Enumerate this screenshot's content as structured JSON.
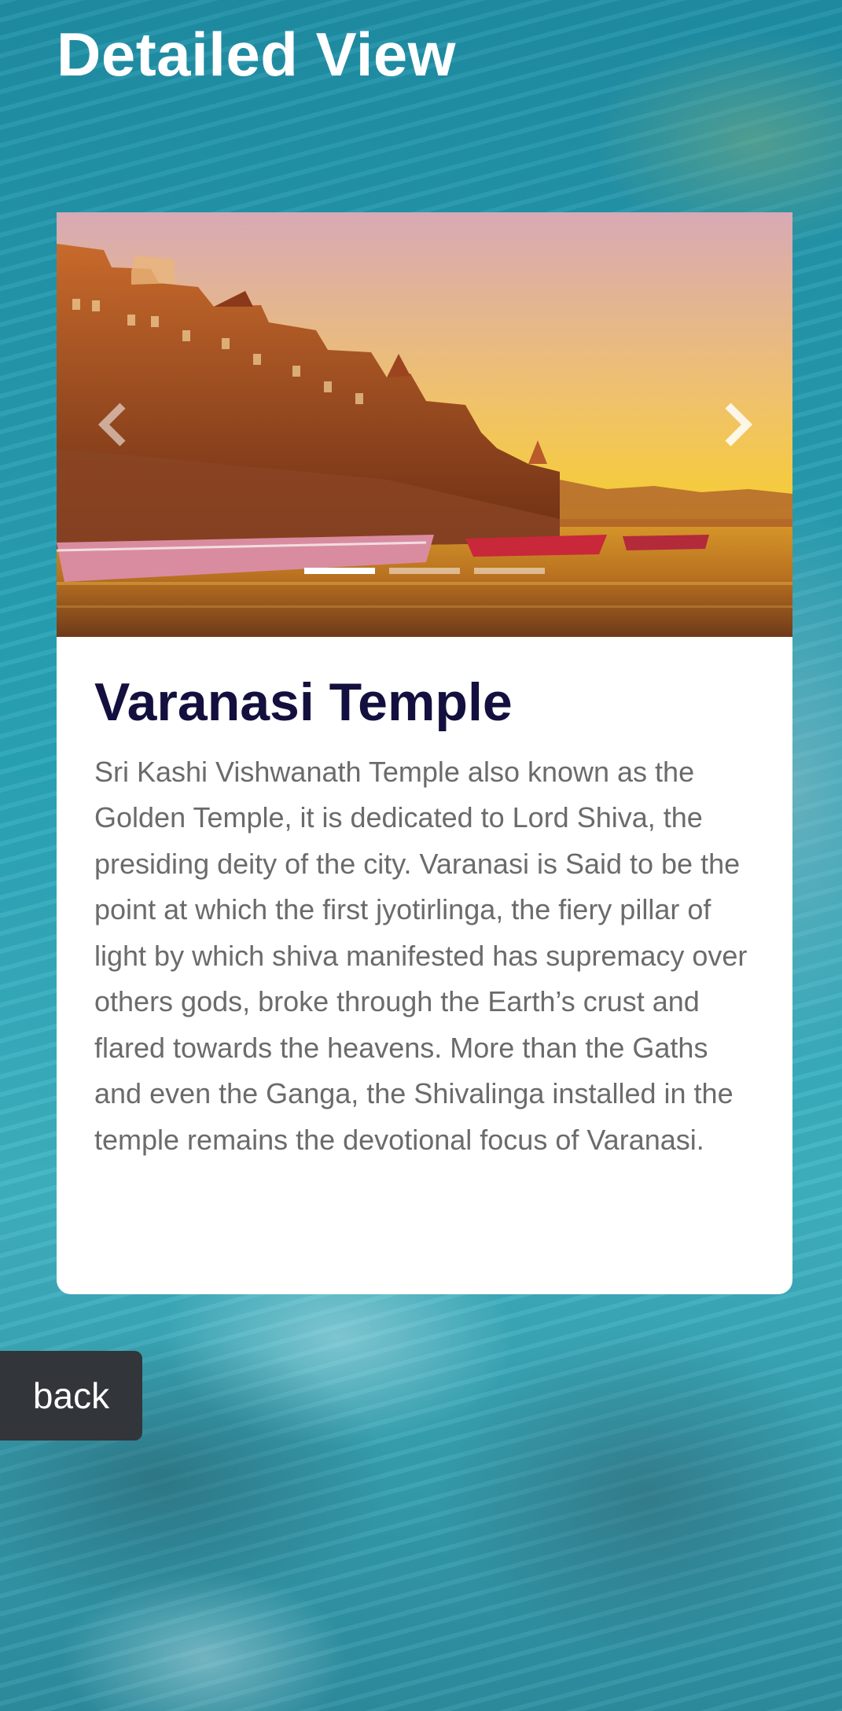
{
  "header": {
    "title": "Detailed View"
  },
  "carousel": {
    "image_alt": "Varanasi ghats at sunset",
    "prev_icon": "chevron-left-icon",
    "next_icon": "chevron-right-icon",
    "slide_count": 3,
    "active_slide": 1
  },
  "card": {
    "title": "Varanasi Temple",
    "description": "Sri Kashi Vishwanath Temple also known as the Golden Temple, it is dedicated to Lord Shiva, the presiding deity of the city. Varanasi is Said to be the point at which the first jyotirlinga, the fiery pillar of light by which shiva manifested has supremacy over others gods, broke through the Earth’s crust and flared towards the heavens. More than the Gaths and even the Ganga, the Shivalinga installed in the temple remains the devotional focus of Varanasi."
  },
  "actions": {
    "back_label": "back"
  },
  "colors": {
    "title_text": "#ffffff",
    "card_title": "#13103f",
    "card_text": "#6b6b6b",
    "back_button_bg": "#323539"
  }
}
